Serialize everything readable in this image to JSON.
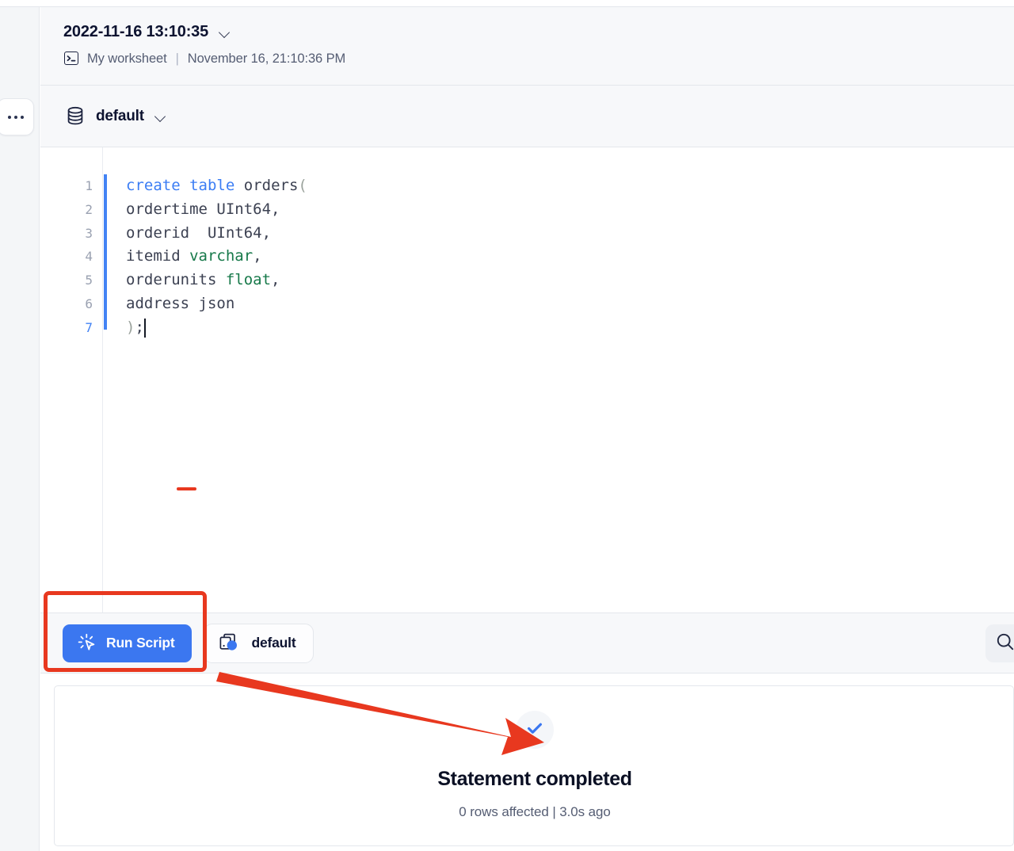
{
  "header": {
    "worksheet_title": "2022-11-16 13:10:35",
    "worksheet_name": "My worksheet",
    "separator": "|",
    "timestamp": "November 16, 21:10:36 PM",
    "chevron_icon": "chevron-down-icon",
    "terminal_icon": "terminal-icon"
  },
  "database_bar": {
    "label": "default",
    "icon": "database-icon",
    "chevron_icon": "chevron-down-icon"
  },
  "editor": {
    "language": "sql",
    "lines": [
      {
        "num": "1",
        "active": false,
        "tokens": [
          {
            "t": "create",
            "c": "kw"
          },
          {
            "t": " ",
            "c": "txt"
          },
          {
            "t": "table",
            "c": "kw"
          },
          {
            "t": " ",
            "c": "txt"
          },
          {
            "t": "orders",
            "c": "txt"
          },
          {
            "t": "(",
            "c": "pn"
          }
        ]
      },
      {
        "num": "2",
        "active": false,
        "tokens": [
          {
            "t": "ordertime UInt64,",
            "c": "txt"
          }
        ]
      },
      {
        "num": "3",
        "active": false,
        "tokens": [
          {
            "t": "orderid  UInt64,",
            "c": "txt"
          }
        ]
      },
      {
        "num": "4",
        "active": false,
        "tokens": [
          {
            "t": "itemid ",
            "c": "txt"
          },
          {
            "t": "varchar",
            "c": "ty"
          },
          {
            "t": ",",
            "c": "txt"
          }
        ]
      },
      {
        "num": "5",
        "active": false,
        "tokens": [
          {
            "t": "orderunits ",
            "c": "txt"
          },
          {
            "t": "float",
            "c": "ty"
          },
          {
            "t": ",",
            "c": "txt"
          }
        ]
      },
      {
        "num": "6",
        "active": false,
        "tokens": [
          {
            "t": "address json",
            "c": "txt"
          }
        ]
      },
      {
        "num": "7",
        "active": true,
        "tokens": [
          {
            "t": ")",
            "c": "pn"
          },
          {
            "t": ";",
            "c": "txt"
          }
        ]
      }
    ],
    "full_text": "create table orders(\nordertime UInt64,\norderid  UInt64,\nitemid varchar,\norderunits float,\naddress json\n);"
  },
  "toolbar": {
    "run_label": "Run Script",
    "run_icon": "cursor-click-icon",
    "chip_label": "default",
    "chip_icon": "database-instance-icon",
    "search_icon": "search-icon"
  },
  "result": {
    "status_icon": "check-icon",
    "title": "Statement completed",
    "subtitle": "0 rows affected | 3.0s ago"
  },
  "left_rail": {
    "more_icon": "ellipsis-icon"
  },
  "annotations": {
    "highlight_target": "Run Script",
    "arrow_from": "run-script-button",
    "arrow_to": "statement-completed-result"
  },
  "colors": {
    "accent_blue": "#3b77f0",
    "annotation_red": "#e8381f",
    "keyword_blue": "#3b7df4",
    "type_green": "#17794a",
    "panel_gray": "#f7f8fa",
    "border_gray": "#e4e7ec",
    "text_dark": "#0d1330",
    "text_muted": "#555d73"
  }
}
